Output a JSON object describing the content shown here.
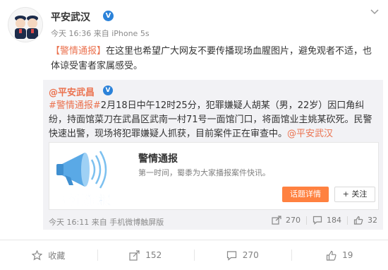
{
  "post": {
    "author": "平安武汉",
    "verify_mark": "V",
    "meta": "今天 16:36 来自 iPhone 5s",
    "text_tag": "【警情通报】",
    "text_body": "在这里也希望广大网友不要传播现场血腥图片，避免观者不适，也体谅受害者家属感受。"
  },
  "retweet": {
    "author": "@平安武昌",
    "verify_mark": "V",
    "hashtag": "#警情通报#",
    "text_body": "2月18日中午12时25分，犯罪嫌疑人胡某（男，22岁）因口角纠纷，持面馆菜刀在武昌区武南一村71号一面馆门口，将面馆业主姚某砍死。民警快速出警，现场将犯罪嫌疑人抓获，目前案件正在审查中。",
    "mention": "@平安武汉",
    "card": {
      "thumb_caption": "警情通报",
      "title": "警情通报",
      "desc": "第一时间，蜀黍为大家播报案件快讯。",
      "detail_button": "话题详情",
      "follow_button": "+ 关注"
    },
    "meta": "今天 16:11 来自 手机微博触屏版",
    "shares": "270",
    "comments": "184",
    "likes": "32"
  },
  "actions": {
    "collect": "收藏",
    "share": "152",
    "comment": "270",
    "like": "19"
  },
  "colors": {
    "accent": "#eb7350",
    "verify": "#2b82d9",
    "button": "#ff8140"
  }
}
